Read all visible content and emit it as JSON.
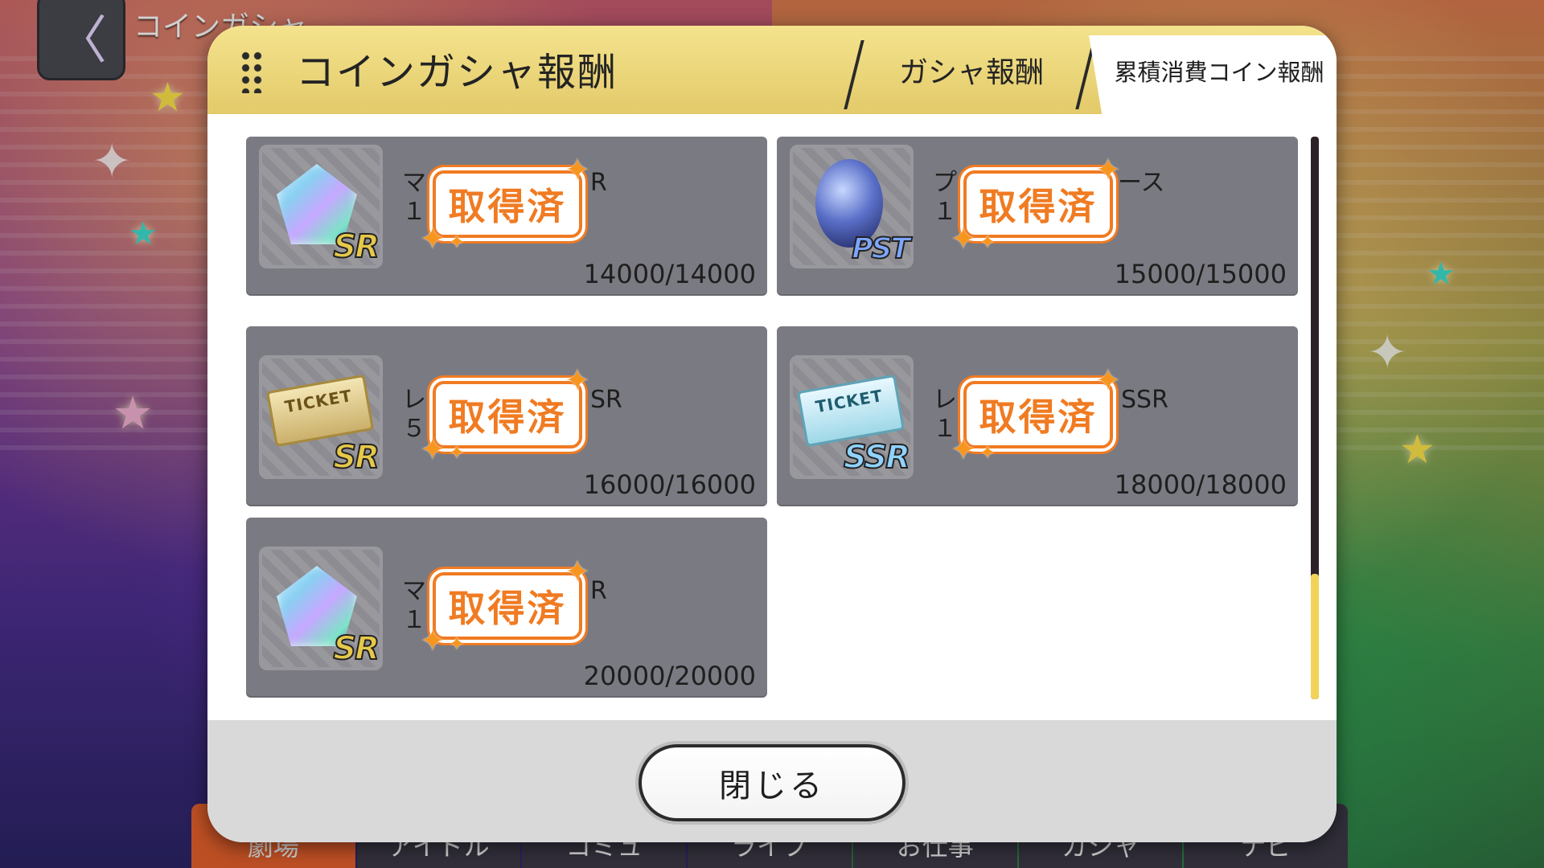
{
  "screen": {
    "title": "コインガシャ",
    "back_glyph": "〈"
  },
  "bottom_nav": {
    "items": [
      {
        "label": "劇場",
        "active": true
      },
      {
        "label": "アイドル",
        "active": false
      },
      {
        "label": "コミュ",
        "active": false
      },
      {
        "label": "ライブ",
        "active": false
      },
      {
        "label": "お仕事",
        "active": false
      },
      {
        "label": "ガシャ",
        "active": false
      },
      {
        "label": "ナビ",
        "active": false
      }
    ]
  },
  "modal": {
    "title": "コインガシャ報酬",
    "tabs": [
      {
        "label": "ガシャ報酬",
        "active": false
      },
      {
        "label": "累積消費コイン報酬",
        "active": true
      }
    ],
    "stamp_label": "取得済",
    "rewards": [
      {
        "name_line1": "マ",
        "name_tail1": "R",
        "name_line2": "１",
        "rarity": "SR",
        "icon": "gem-icon",
        "progress": "14000/14000",
        "current": 14000,
        "required": 14000,
        "obtained": true
      },
      {
        "name_line1": "プ",
        "name_tail1": "ース",
        "name_line2": "１",
        "rarity": "PST",
        "icon": "jewel-icon",
        "progress": "15000/15000",
        "current": 15000,
        "required": 15000,
        "obtained": true
      },
      {
        "name_line1": "レ",
        "name_tail1": "SR",
        "name_line2": "５",
        "rarity": "SR",
        "icon": "ticket-icon",
        "ticket_text": "TICKET",
        "progress": "16000/16000",
        "current": 16000,
        "required": 16000,
        "obtained": true
      },
      {
        "name_line1": "レ",
        "name_tail1": "SSR",
        "name_line2": "１",
        "rarity": "SSR",
        "icon": "ticket-icon",
        "ticket_text": "TICKET",
        "progress": "18000/18000",
        "current": 18000,
        "required": 18000,
        "obtained": true
      },
      {
        "name_line1": "マ",
        "name_tail1": "R",
        "name_line2": "１",
        "rarity": "SR",
        "icon": "gem-icon",
        "progress": "20000/20000",
        "current": 20000,
        "required": 20000,
        "obtained": true
      }
    ],
    "close_label": "閉じる"
  },
  "colors": {
    "header_gold": "#e3ca6a",
    "stamp_orange": "#f07b22",
    "card_gray": "#7a7a82",
    "scroll_thumb": "#f2d35a",
    "nav_active": "#e7612d"
  }
}
